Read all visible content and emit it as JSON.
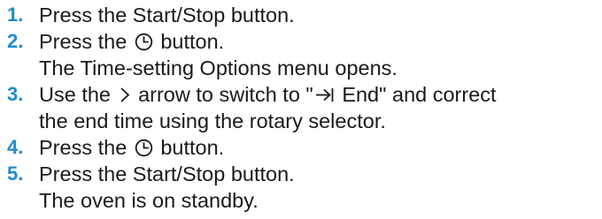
{
  "steps": [
    {
      "number": "1.",
      "lines": [
        {
          "before": "Press the Start/Stop button."
        }
      ]
    },
    {
      "number": "2.",
      "lines": [
        {
          "before": "Press the",
          "icon": "clock-icon",
          "after": "button."
        },
        {
          "before": "The Time-setting Options menu opens."
        }
      ]
    },
    {
      "number": "3.",
      "lines": [
        {
          "before": "Use the",
          "icon": "chevron-right-icon",
          "after": "arrow to switch to \"",
          "icon2": "arrow-to-bar-icon",
          "after2": "End\" and correct"
        },
        {
          "before": "the end time using the rotary selector."
        }
      ]
    },
    {
      "number": "4.",
      "lines": [
        {
          "before": "Press the",
          "icon": "clock-icon",
          "after": "button."
        }
      ]
    },
    {
      "number": "5.",
      "lines": [
        {
          "before": "Press the Start/Stop button."
        },
        {
          "before": "The oven is on standby."
        }
      ]
    }
  ],
  "colors": {
    "number": "#1f8bd0",
    "text": "#1a1a1a"
  }
}
